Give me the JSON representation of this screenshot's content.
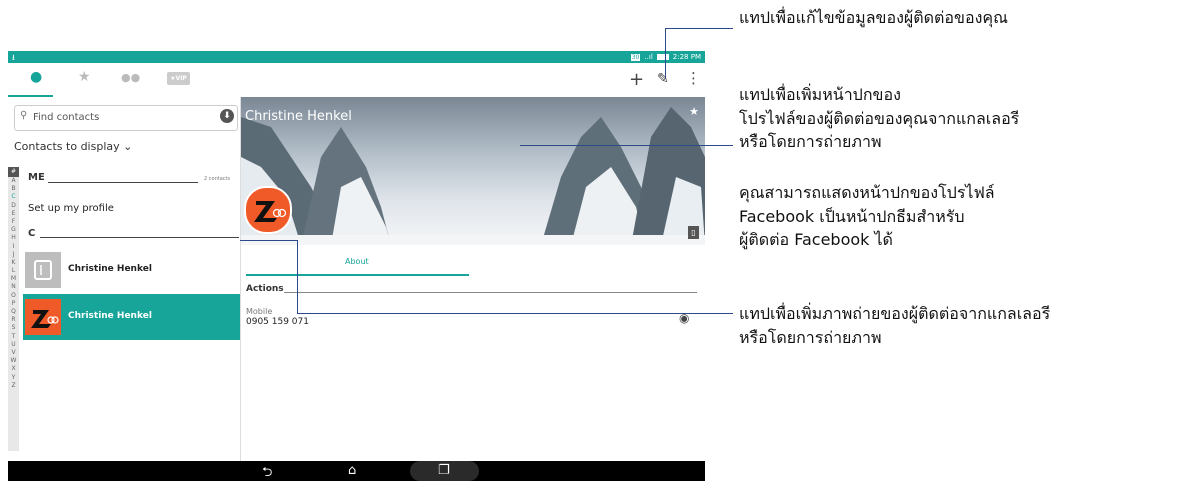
{
  "status_bar": {
    "time": "2:28 PM",
    "badge": "30",
    "signal": "..ıl"
  },
  "action_bar": {
    "add_label": "+",
    "edit_icon": "pencil-icon",
    "more_label": "⋮",
    "vip_label": "★VIP"
  },
  "search": {
    "placeholder": "Find contacts"
  },
  "contacts_to_display": "Contacts to display",
  "alphabet": [
    "#",
    "A",
    "B",
    "C",
    "D",
    "E",
    "F",
    "G",
    "H",
    "I",
    "J",
    "K",
    "L",
    "M",
    "N",
    "O",
    "P",
    "Q",
    "R",
    "S",
    "T",
    "U",
    "V",
    "W",
    "X",
    "Y",
    "Z"
  ],
  "sections": {
    "me_header": "ME",
    "me_count": "2 contacts",
    "profile_link": "Set up my profile",
    "c_header": "C"
  },
  "contacts": [
    {
      "name": "Christine Henkel",
      "selected": false
    },
    {
      "name": "Christine Henkel",
      "selected": true
    }
  ],
  "detail": {
    "cover_name": "Christine Henkel",
    "about_tab": "About",
    "actions_label": "Actions",
    "mobile_label": "Mobile",
    "mobile_number": "0905 159 071"
  },
  "colors": {
    "accent": "#17a59a",
    "brand_orange": "#f05a28"
  },
  "callouts": {
    "edit": "แทปเพื่อแก้ไขข้อมูลของผู้ติดต่อของคุณ",
    "cover_line1": "แทปเพื่อเพิ่มหน้าปกของ",
    "cover_line2": "โปรไฟล์ของผู้ติดต่อของคุณจากแกลเลอรี",
    "cover_line3": "หรือโดยการถ่ายภาพ",
    "facebook_line1": "คุณสามารถแสดงหน้าปกของโปรไฟล์",
    "facebook_line2": "Facebook เป็นหน้าปกธีมสำหรับ",
    "facebook_line3": "ผู้ติดต่อ Facebook ได้",
    "photo_line1": "แทปเพื่อเพิ่มภาพถ่ายของผู้ติดต่อจากแกลเลอรี",
    "photo_line2": "หรือโดยการถ่ายภาพ"
  }
}
